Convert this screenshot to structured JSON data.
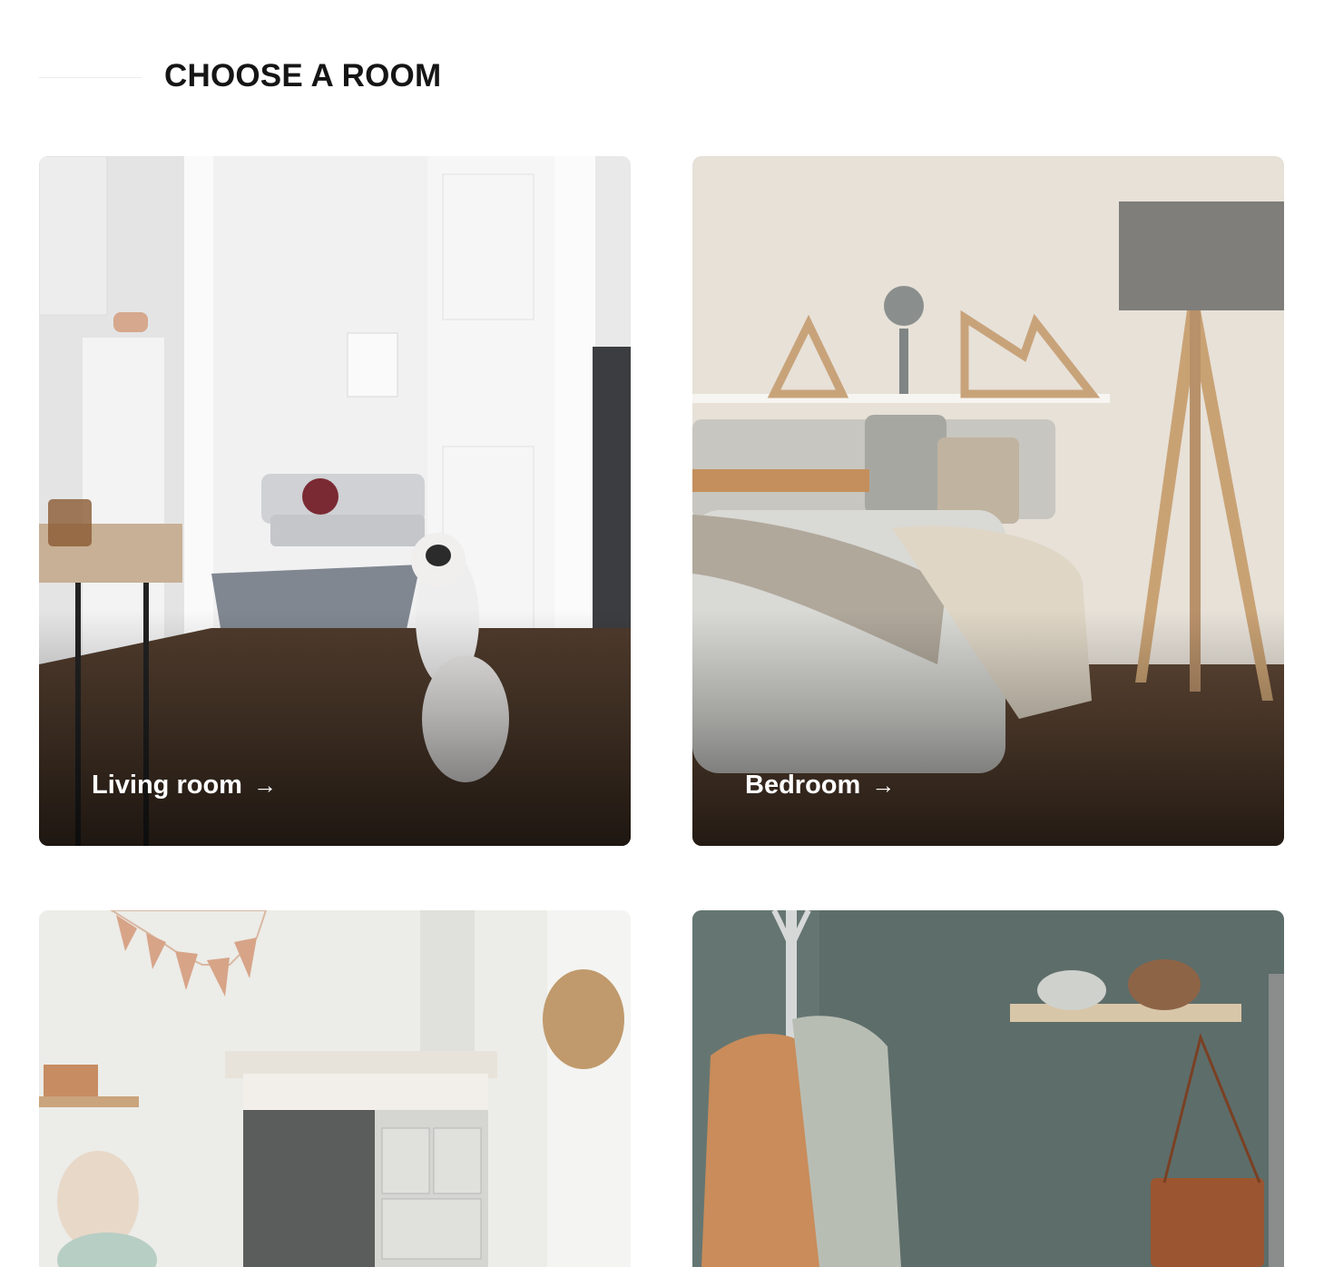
{
  "header": {
    "title": "CHOOSE A ROOM"
  },
  "rooms": [
    {
      "label": "Living room",
      "arrow": "→",
      "image": "living-room-photo"
    },
    {
      "label": "Bedroom",
      "arrow": "→",
      "image": "bedroom-photo"
    },
    {
      "label": "",
      "arrow": "",
      "image": "kids-room-photo"
    },
    {
      "label": "",
      "arrow": "",
      "image": "hallway-photo"
    }
  ],
  "colors": {
    "title": "#151515",
    "label": "#ffffff",
    "background": "#ffffff"
  }
}
